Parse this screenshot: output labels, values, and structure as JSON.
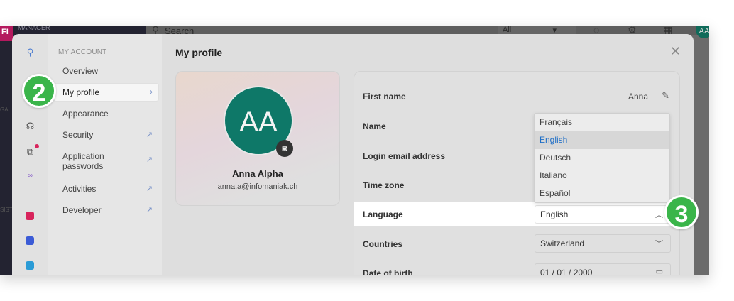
{
  "background": {
    "logo": "FI",
    "manager_text": "MANAGER",
    "search_placeholder": "Search",
    "all_select": "All",
    "avatar_initials": "AA",
    "rail_label_1": "GA",
    "rail_label_2": "SIST"
  },
  "sidebar": {
    "section_title": "MY ACCOUNT",
    "items": [
      {
        "label": "Overview"
      },
      {
        "label": "My profile"
      },
      {
        "label": "Appearance"
      },
      {
        "label": "Security"
      },
      {
        "label": "Application passwords"
      },
      {
        "label": "Activities"
      },
      {
        "label": "Developer"
      }
    ]
  },
  "main": {
    "title": "My profile"
  },
  "profile_card": {
    "initials": "AA",
    "name": "Anna Alpha",
    "email": "anna.a@infomaniak.ch"
  },
  "form": {
    "first_name_label": "First name",
    "first_name_value": "Anna",
    "name_label": "Name",
    "login_email_label": "Login email address",
    "timezone_label": "Time zone",
    "language_label": "Language",
    "language_value": "English",
    "countries_label": "Countries",
    "countries_value": "Switzerland",
    "dob_label": "Date of birth",
    "dob_value": "01 / 01 / 2000"
  },
  "language_dropdown": {
    "options": [
      "Français",
      "English",
      "Deutsch",
      "Italiano",
      "Español"
    ],
    "selected": "English"
  },
  "callouts": {
    "step_2": "2",
    "step_3": "3"
  },
  "colors": {
    "avatar": "#0e7868",
    "callout": "#3ab54a",
    "selected_option": "#1f6fc7",
    "link_icon": "#7b94c9"
  }
}
